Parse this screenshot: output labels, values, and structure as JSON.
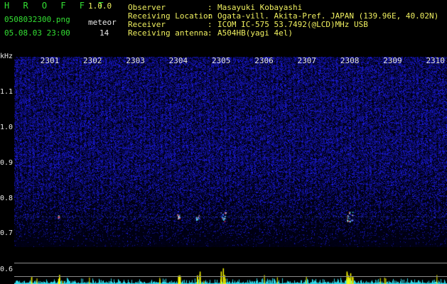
{
  "header": {
    "brand": "H R O F F T",
    "version": "1.0.0",
    "filename": "0508032300.png",
    "meteor_label": "meteor",
    "datetime": "05.08.03 23:00",
    "meteor_count": "14"
  },
  "info": [
    {
      "label": "Observer",
      "value": "Masayuki Kobayashi"
    },
    {
      "label": "Receiving Location",
      "value": "Ogata-vill. Akita-Pref. JAPAN (139.96E, 40.02N)"
    },
    {
      "label": "Receiver",
      "value": "ICOM IC-575 53.7492(@LCD)MHz USB"
    },
    {
      "label": "Receiving antenna",
      "value": "A504HB(yagi 4el)"
    }
  ],
  "axis": {
    "unit": "kHz",
    "y_labels": [
      "1.1",
      "1.0",
      "0.9",
      "0.8",
      "0.7",
      "0.6"
    ],
    "time_labels": [
      "2301",
      "2302",
      "2303",
      "2304",
      "2305",
      "2306",
      "2307",
      "2308",
      "2309",
      "2310"
    ]
  },
  "meteor_echoes": [
    {
      "time": 2301.2,
      "strength": 0.3
    },
    {
      "time": 2304.0,
      "strength": 0.5
    },
    {
      "time": 2304.45,
      "strength": 0.6
    },
    {
      "time": 2305.05,
      "strength": 0.9
    },
    {
      "time": 2308.0,
      "strength": 1.0
    }
  ],
  "colors": {
    "background": "#000000",
    "noise": "#2626c8",
    "label_green": "#33e033",
    "label_yellow": "#f0f060",
    "label_white": "#e8e8e8",
    "signal_yellow": "#ffff00",
    "signal_cyan": "#30d8e8"
  }
}
